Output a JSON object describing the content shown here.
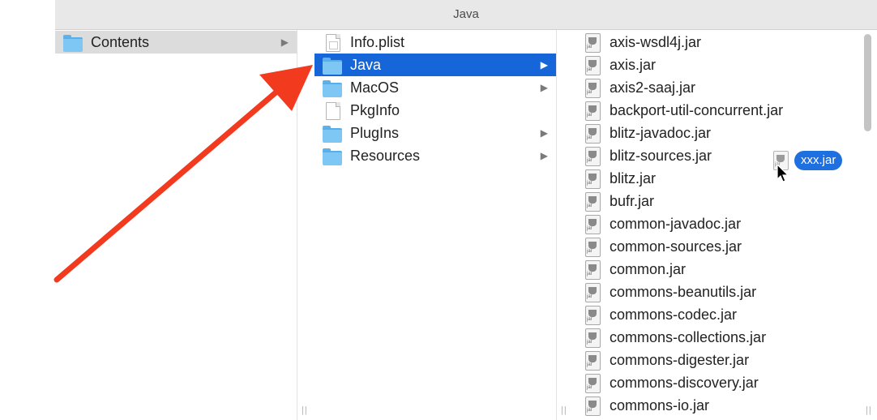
{
  "window": {
    "title": "Java"
  },
  "column1": {
    "items": [
      {
        "label": "Contents",
        "icon": "folder-icon",
        "has_children": true
      }
    ]
  },
  "column2": {
    "items": [
      {
        "label": "Info.plist",
        "icon": "plist-file-icon",
        "has_children": false,
        "selected": false
      },
      {
        "label": "Java",
        "icon": "folder-icon",
        "has_children": true,
        "selected": true
      },
      {
        "label": "MacOS",
        "icon": "folder-icon",
        "has_children": true,
        "selected": false
      },
      {
        "label": "PkgInfo",
        "icon": "document-icon",
        "has_children": false,
        "selected": false
      },
      {
        "label": "PlugIns",
        "icon": "folder-icon",
        "has_children": true,
        "selected": false
      },
      {
        "label": "Resources",
        "icon": "folder-icon",
        "has_children": true,
        "selected": false
      }
    ]
  },
  "column3": {
    "items": [
      "axis-wsdl4j.jar",
      "axis.jar",
      "axis2-saaj.jar",
      "backport-util-concurrent.jar",
      "blitz-javadoc.jar",
      "blitz-sources.jar",
      "blitz.jar",
      "bufr.jar",
      "common-javadoc.jar",
      "common-sources.jar",
      "common.jar",
      "commons-beanutils.jar",
      "commons-codec.jar",
      "commons-collections.jar",
      "commons-digester.jar",
      "commons-discovery.jar",
      "commons-io.jar"
    ]
  },
  "drag": {
    "label": "xxx.jar",
    "icon": "jar-file-icon"
  },
  "colors": {
    "selection": "#1766d9",
    "folder": "#7ec6f3",
    "annotation_arrow": "#f23a1f",
    "drag_pill": "#1e6fe0"
  }
}
